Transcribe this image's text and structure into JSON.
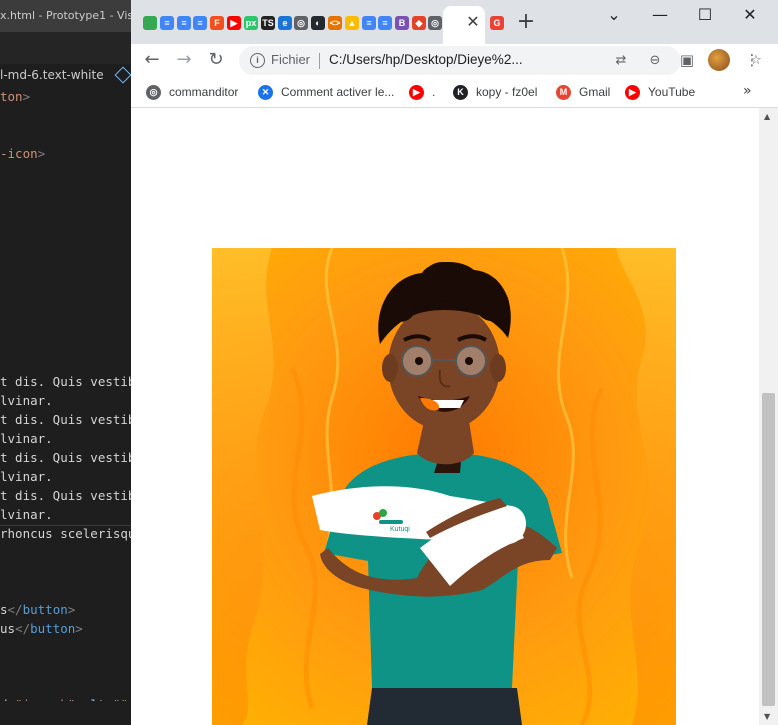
{
  "vscode": {
    "title": "x.html - Prototype1 - Vis",
    "breadcrumb": "l-md-6.text-white",
    "code_lines": [
      {
        "segments": [
          {
            "t": "ton",
            "c": "c-str"
          },
          {
            "t": ">",
            "c": "c-punc"
          }
        ]
      },
      {
        "segments": [
          {
            "t": "-icon",
            "c": "c-str"
          },
          {
            "t": ">",
            "c": "c-punc"
          }
        ]
      },
      {
        "segments": [
          {
            "t": "t dis. Quis vestib",
            "c": ""
          }
        ]
      },
      {
        "segments": [
          {
            "t": "lvinar.",
            "c": ""
          }
        ]
      },
      {
        "segments": [
          {
            "t": "t dis. Quis vestib",
            "c": ""
          }
        ]
      },
      {
        "segments": [
          {
            "t": "lvinar.",
            "c": ""
          }
        ]
      },
      {
        "segments": [
          {
            "t": "t dis. Quis vestib",
            "c": ""
          }
        ]
      },
      {
        "segments": [
          {
            "t": "lvinar.",
            "c": ""
          }
        ]
      },
      {
        "segments": [
          {
            "t": "t dis. Quis vestib",
            "c": ""
          }
        ]
      },
      {
        "segments": [
          {
            "t": "lvinar.",
            "c": ""
          }
        ]
      },
      {
        "segments": [
          {
            "t": "rhoncus scelerisqu",
            "c": ""
          }
        ]
      },
      {
        "segments": [
          {
            "t": "s",
            "c": ""
          },
          {
            "t": "</",
            "c": "c-punc"
          },
          {
            "t": "button",
            "c": "c-tag"
          },
          {
            "t": ">",
            "c": "c-punc"
          }
        ]
      },
      {
        "segments": [
          {
            "t": "us",
            "c": ""
          },
          {
            "t": "</",
            "c": "c-punc"
          },
          {
            "t": "button",
            "c": "c-tag"
          },
          {
            "t": ">",
            "c": "c-punc"
          }
        ]
      },
      {
        "segments": [
          {
            "t": "d ",
            "c": "c-attr"
          },
          {
            "t": "\"imageh\"",
            "c": "c-str"
          },
          {
            "t": " alt ",
            "c": "c-attr"
          },
          {
            "t": "\"\"",
            "c": "c-str"
          }
        ]
      }
    ]
  },
  "chrome": {
    "tab_favicons": [
      {
        "name": "google-ads-favicon",
        "color": "#34a853",
        "glyph": ""
      },
      {
        "name": "google-docs-favicon",
        "color": "#4285f4",
        "glyph": "≡"
      },
      {
        "name": "google-docs-favicon",
        "color": "#4285f4",
        "glyph": "≡"
      },
      {
        "name": "google-docs-favicon",
        "color": "#4285f4",
        "glyph": "≡"
      },
      {
        "name": "figma-favicon",
        "color": "#f24e1e",
        "glyph": "F"
      },
      {
        "name": "youtube-favicon",
        "color": "#ff0000",
        "glyph": "▶"
      },
      {
        "name": "pixabay-favicon",
        "color": "#2ec66d",
        "glyph": "px"
      },
      {
        "name": "ts-favicon",
        "color": "#222222",
        "glyph": "TS"
      },
      {
        "name": "edge-favicon",
        "color": "#1d74d8",
        "glyph": "e"
      },
      {
        "name": "globe-favicon",
        "color": "#5f6368",
        "glyph": "◎"
      },
      {
        "name": "github-favicon",
        "color": "#24292f",
        "glyph": "◐"
      },
      {
        "name": "code-favicon",
        "color": "#e37400",
        "glyph": "<>"
      },
      {
        "name": "drive-favicon",
        "color": "#fbbc04",
        "glyph": "▲"
      },
      {
        "name": "google-docs-favicon",
        "color": "#4285f4",
        "glyph": "≡"
      },
      {
        "name": "google-docs-favicon",
        "color": "#4285f4",
        "glyph": "≡"
      },
      {
        "name": "bootstrap-favicon",
        "color": "#7952b3",
        "glyph": "B"
      },
      {
        "name": "gitlab-favicon",
        "color": "#e24329",
        "glyph": "◆"
      },
      {
        "name": "globe-favicon",
        "color": "#5f6368",
        "glyph": "◎"
      },
      {
        "name": "google-favicon",
        "color": "#ea4335",
        "glyph": "G"
      }
    ],
    "new_tab_label": "+",
    "address": {
      "label": "Fichier",
      "url": "C:/Users/hp/Desktop/Dieye%2..."
    },
    "bookmarks": [
      {
        "name": "bookmark-commanditor",
        "label": "commanditor",
        "icon_color": "#5f6368",
        "glyph": "◎"
      },
      {
        "name": "bookmark-activer",
        "label": "Comment activer le...",
        "icon_color": "#1a73e8",
        "glyph": "✕"
      },
      {
        "name": "bookmark-youtube-dot",
        "label": ".",
        "icon_color": "#ff0000",
        "glyph": "▶"
      },
      {
        "name": "bookmark-kopy",
        "label": "kopy - fz0el",
        "icon_color": "#202124",
        "glyph": "K"
      },
      {
        "name": "bookmark-gmail",
        "label": "Gmail",
        "icon_color": "#ea4335",
        "glyph": "M"
      },
      {
        "name": "bookmark-youtube",
        "label": "YouTube",
        "icon_color": "#ff0000",
        "glyph": "▶"
      }
    ],
    "hero_badge_text": "Kutuqi"
  }
}
